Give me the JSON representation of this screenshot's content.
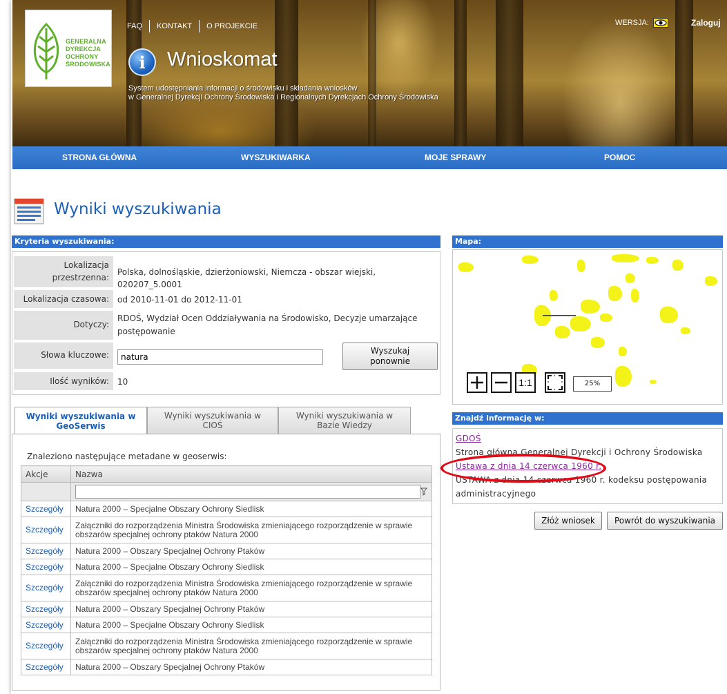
{
  "header": {
    "top_links": [
      "FAQ",
      "KONTAKT",
      "O PROJEKCIE"
    ],
    "version_label": "WERSJA:",
    "login": "Zaloguj",
    "app_title": "Wnioskomat",
    "subtitle_line1": "System udostępniania informacji o środowisku i składania wniosków",
    "subtitle_line2": "w Generalnej Dyrekcji Ochrony Środowiska i Regionalnych Dyrekcjach Ochrony Środowiska",
    "logo_lines": [
      "GENERALNA",
      "DYREKCJA",
      "OCHRONY",
      "ŚRODOWISKA"
    ]
  },
  "nav": {
    "items": [
      "STRONA GŁÓWNA",
      "WYSZUKIWARKA",
      "MOJE SPRAWY",
      "POMOC"
    ]
  },
  "page_title": "Wyniki wyszukiwania",
  "criteria": {
    "header": "Kryteria wyszukiwania:",
    "spatial_label_1": "Lokalizacja",
    "spatial_label_2": "przestrzenna:",
    "spatial_value": "Polska, dolnośląskie, dzierżoniowski, Niemcza - obszar wiejski, 020207_5.0001",
    "time_label": "Lokalizacja czasowa:",
    "time_value": "od 2010-11-01 do 2012-11-01",
    "concerns_label": "Dotyczy:",
    "concerns_value_1": "RDOŚ, Wydział Ocen Oddziaływania na Środowisko, Decyzje umarzające",
    "concerns_value_2": "postępowanie",
    "keywords_label": "Słowa kluczowe:",
    "keywords_value": "natura",
    "search_again": "Wyszukaj ponownie",
    "count_label": "Ilość wyników:",
    "count_value": "10"
  },
  "map": {
    "header": "Mapa:",
    "zoom_in": "+",
    "zoom_out": "—",
    "one_to_one": "1:1",
    "zoom_level": "25%"
  },
  "find": {
    "header": "Znajdź informację w:",
    "link1": "GDOŚ",
    "desc1": "Strona główna Generalnej Dyrekcji i Ochrony Środowiska",
    "link2": "Ustawa z dnia 14 czerwca 1960 r.",
    "desc2": "USTAWA z dnia 14 czerwca 1960 r. kodeksu postępowania administracyjnego"
  },
  "buttons": {
    "submit": "Złóż wniosek",
    "back": "Powrót do wyszukiwania"
  },
  "tabs": [
    "Wyniki wyszukiwania w GeoSerwis",
    "Wyniki wyszukiwania w CIOŚ",
    "Wyniki wyszukiwania w Bazie Wiedzy"
  ],
  "results": {
    "found_text": "Znaleziono następujące metadane w geoserwis:",
    "col_action": "Akcje",
    "col_name": "Nazwa",
    "filter_value": "",
    "details_label": "Szczegóły",
    "rows": [
      "Natura 2000 – Specjalne Obszary Ochrony Siedlisk",
      "Załączniki do rozporządzenia Ministra Środowiska zmieniającego rozporządzenie w sprawie obszarów specjalnej ochrony ptaków Natura 2000",
      "Natura 2000 – Obszary Specjalnej Ochrony Ptaków",
      "Natura 2000 – Specjalne Obszary Ochrony Siedlisk",
      "Załączniki do rozporządzenia Ministra Środowiska zmieniającego rozporządzenie w sprawie obszarów specjalnej ochrony ptaków Natura 2000",
      "Natura 2000 – Obszary Specjalnej Ochrony Ptaków",
      "Natura 2000 – Specjalne Obszary Ochrony Siedlisk",
      "Załączniki do rozporządzenia Ministra Środowiska zmieniającego rozporządzenie w sprawie obszarów specjalnej ochrony ptaków Natura 2000",
      "Natura 2000 – Obszary Specjalnej Ochrony Ptaków"
    ]
  },
  "colors": {
    "brand_blue": "#2f71cf",
    "title_blue": "#1b5fb5",
    "logo_green": "#5fae2c",
    "highlight_red": "#e00c18"
  }
}
